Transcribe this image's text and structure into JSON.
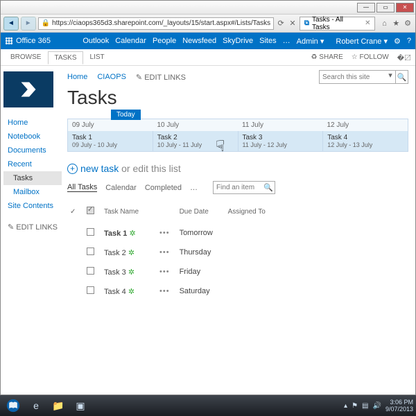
{
  "browser": {
    "url": "https://ciaops365d3.sharepoint.com/_layouts/15/start.aspx#/Lists/Tasks",
    "tab_title": "Tasks - All Tasks"
  },
  "o365": {
    "brand": "Office 365",
    "nav": [
      "Outlook",
      "Calendar",
      "People",
      "Newsfeed",
      "SkyDrive",
      "Sites",
      "…",
      "Admin ▾"
    ],
    "user": "Robert Crane ▾"
  },
  "ribbon": {
    "tabs": [
      "BROWSE",
      "TASKS",
      "LIST"
    ],
    "actions": [
      "SHARE",
      "FOLLOW"
    ]
  },
  "breadcrumb": {
    "home": "Home",
    "site": "CIAOPS",
    "edit": "EDIT LINKS"
  },
  "search": {
    "placeholder": "Search this site"
  },
  "page_title": "Tasks",
  "quicklaunch": {
    "items": [
      "Home",
      "Notebook",
      "Documents",
      "Recent"
    ],
    "sub": [
      "Tasks",
      "Mailbox"
    ],
    "after": [
      "Site Contents"
    ],
    "edit": "EDIT LINKS"
  },
  "timeline": {
    "today": "Today",
    "dates": [
      "09 July",
      "10 July",
      "11 July",
      "12 July"
    ],
    "tasks": [
      {
        "n": "Task 1",
        "r": "09 July - 10 July"
      },
      {
        "n": "Task 2",
        "r": "10 July - 11 July"
      },
      {
        "n": "Task 3",
        "r": "11 July - 12 July"
      },
      {
        "n": "Task 4",
        "r": "12 July - 13 July"
      }
    ]
  },
  "newtask": {
    "new": "new task",
    "or": " or ",
    "edit": "edit this list"
  },
  "views": [
    "All Tasks",
    "Calendar",
    "Completed",
    "…"
  ],
  "find_placeholder": "Find an item",
  "table": {
    "headers": [
      "",
      "",
      "Task Name",
      "",
      "Due Date",
      "Assigned To"
    ],
    "rows": [
      {
        "name": "Task 1",
        "new": true,
        "bold": true,
        "due": "Tomorrow"
      },
      {
        "name": "Task 2",
        "new": true,
        "bold": false,
        "due": "Thursday"
      },
      {
        "name": "Task 3",
        "new": true,
        "bold": false,
        "due": "Friday"
      },
      {
        "name": "Task 4",
        "new": true,
        "bold": false,
        "due": "Saturday"
      }
    ]
  },
  "taskbar": {
    "time": "3:06 PM",
    "date": "9/07/2013"
  }
}
